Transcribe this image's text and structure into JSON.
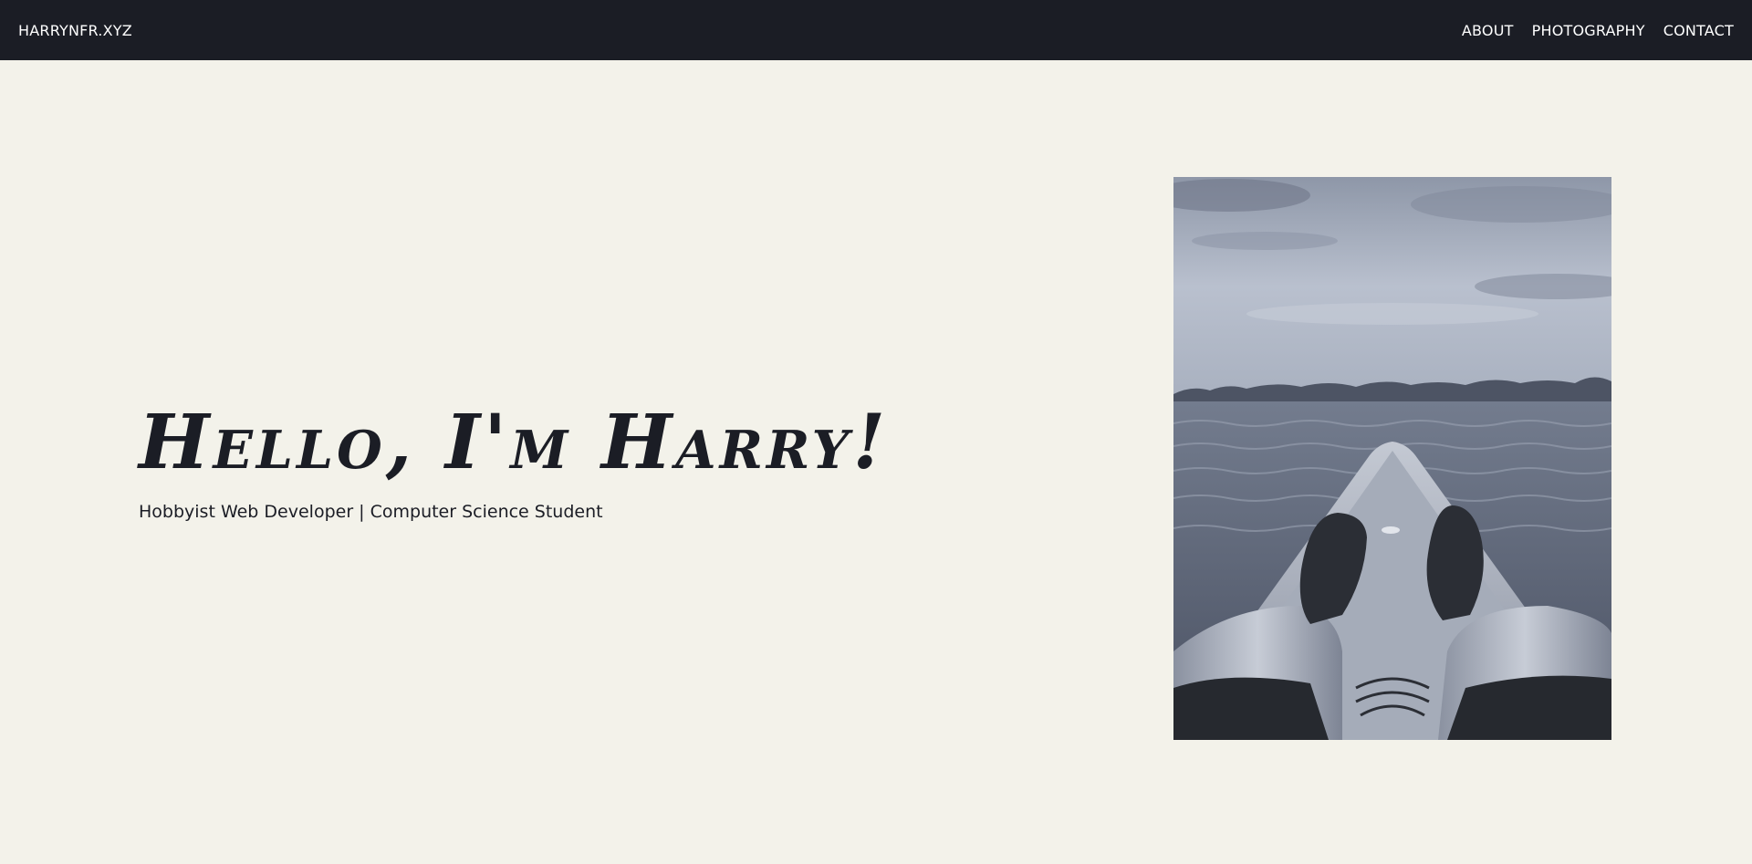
{
  "nav": {
    "brand": "HARRYNFR.XYZ",
    "links": [
      {
        "label": "ABOUT"
      },
      {
        "label": "PHOTOGRAPHY"
      },
      {
        "label": "CONTACT"
      }
    ]
  },
  "hero": {
    "title": "Hello, I'm Harry!",
    "subtitle": "Hobbyist Web Developer | Computer Science Student"
  },
  "colors": {
    "navbar_bg": "#1b1d25",
    "page_bg": "#f3f2ea",
    "text": "#1b1d25"
  }
}
